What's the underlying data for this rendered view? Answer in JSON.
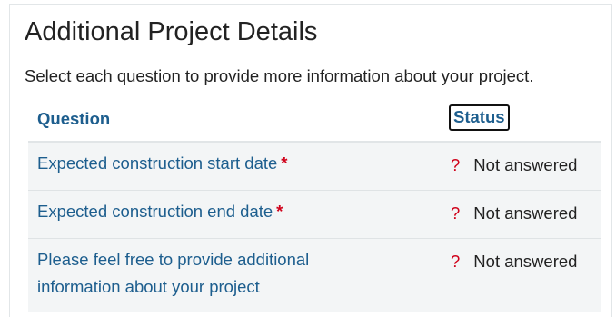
{
  "page": {
    "title": "Additional Project Details",
    "intro": "Select each question to provide more information about your project."
  },
  "table": {
    "headers": {
      "question": "Question",
      "status": "Status"
    },
    "rows": [
      {
        "question": "Expected construction start date",
        "required_marker": "*",
        "status_icon": "?",
        "status": "Not answered"
      },
      {
        "question": "Expected construction end date",
        "required_marker": "*",
        "status_icon": "?",
        "status": "Not answered"
      },
      {
        "question": "Please feel free to provide additional information about your project",
        "status_icon": "?",
        "status": "Not answered"
      }
    ]
  },
  "colors": {
    "link": "#1d5e8e",
    "required": "#d0021b",
    "row_background": "#f3f5f6"
  },
  "icons": {
    "status_unanswered": "question-mark-icon"
  }
}
